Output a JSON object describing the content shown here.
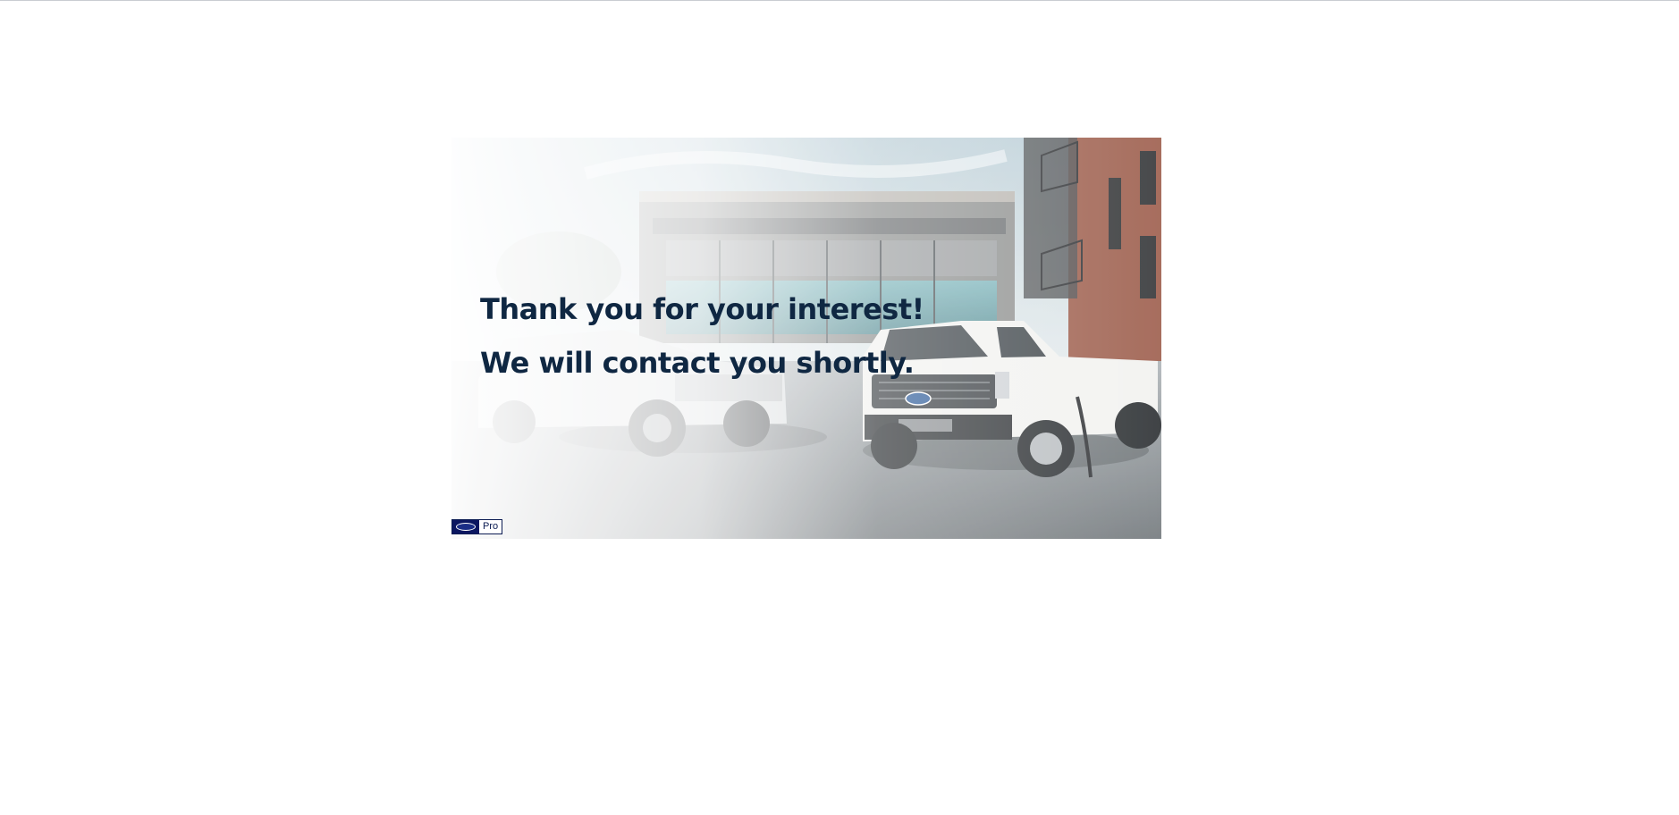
{
  "banner": {
    "headline_line1": "Thank you for your interest!",
    "headline_line2": "We will contact you shortly.",
    "text_color": "#0f2742"
  },
  "logo": {
    "brand_icon": "ford-oval-icon",
    "label": "Pro",
    "color": "#0b1660"
  }
}
